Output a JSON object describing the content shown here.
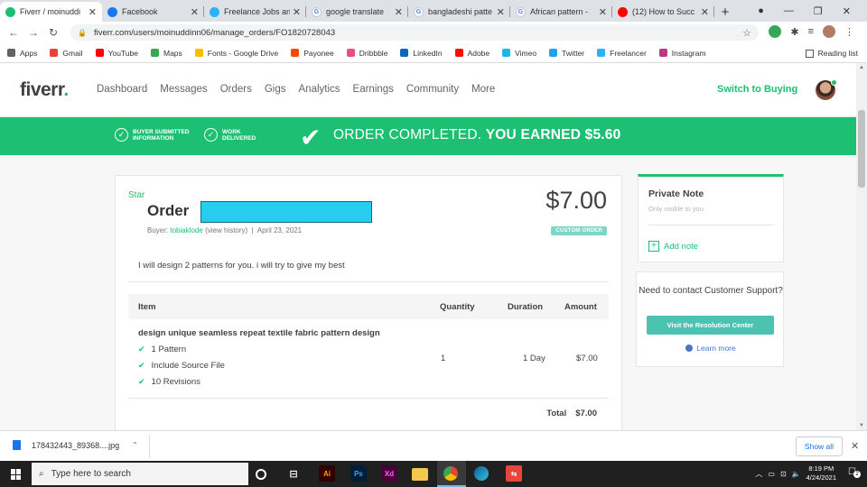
{
  "browser": {
    "tabs": [
      {
        "title": "Fiverr / moinuddi",
        "icon": "fiverr-icon",
        "color": "#1dbf73",
        "active": true
      },
      {
        "title": "Facebook",
        "icon": "facebook-icon",
        "color": "#1877f2",
        "active": false
      },
      {
        "title": "Freelance Jobs an",
        "icon": "freelancer-icon",
        "color": "#29b2fe",
        "active": false
      },
      {
        "title": "google translate",
        "icon": "google-icon",
        "color": "#ffffff",
        "active": false
      },
      {
        "title": "bangladeshi patte",
        "icon": "google-icon",
        "color": "#ffffff",
        "active": false
      },
      {
        "title": "African pattern -",
        "icon": "google-icon",
        "color": "#ffffff",
        "active": false
      },
      {
        "title": "(12) How to Succ",
        "icon": "youtube-icon",
        "color": "#ff0000",
        "active": false
      }
    ],
    "url": "fiverr.com/users/moinuddinn06/manage_orders/FO1820728043",
    "bookmarks": [
      {
        "label": "Apps",
        "color": "#5f6368"
      },
      {
        "label": "Gmail",
        "color": "#ea4335"
      },
      {
        "label": "YouTube",
        "color": "#ff0000"
      },
      {
        "label": "Maps",
        "color": "#34a853"
      },
      {
        "label": "Fonts - Google Drive",
        "color": "#fbbc04"
      },
      {
        "label": "Payonee",
        "color": "#ff4800"
      },
      {
        "label": "Dribbble",
        "color": "#ea4c89"
      },
      {
        "label": "LinkedIn",
        "color": "#0a66c2"
      },
      {
        "label": "Adobe",
        "color": "#fa0f00"
      },
      {
        "label": "Vimeo",
        "color": "#1ab7ea"
      },
      {
        "label": "Twitter",
        "color": "#1da1f2"
      },
      {
        "label": "Freelancer",
        "color": "#29b2fe"
      },
      {
        "label": "Instagram",
        "color": "#c13584"
      }
    ],
    "reading_list": "Reading list"
  },
  "fiverr": {
    "logo": "fiverr",
    "nav": [
      "Dashboard",
      "Messages",
      "Orders",
      "Gigs",
      "Analytics",
      "Earnings",
      "Community",
      "More"
    ],
    "switch_label": "Switch to Buying",
    "banner": {
      "step1": "BUYER SUBMITTED INFORMATION",
      "step2": "WORK DELIVERED",
      "message_plain": "ORDER COMPLETED.",
      "message_bold": "YOU EARNED $5.60"
    },
    "order": {
      "star": "Star",
      "title": "Order",
      "buyer_prefix": "Buyer:",
      "buyer_name": "tobiaklode",
      "view_history": "(view history)",
      "separator": "|",
      "date": "April 23, 2021",
      "price": "$7.00",
      "badge": "CUSTOM ORDER",
      "description": "I will design 2 patterns for you. i will try to give my best",
      "columns": {
        "item": "Item",
        "quantity": "Quantity",
        "duration": "Duration",
        "amount": "Amount"
      },
      "item_name": "design unique seamless repeat textile fabric pattern design",
      "features": [
        "1 Pattern",
        "Include Source File",
        "10 Revisions"
      ],
      "quantity": "1",
      "duration": "1 Day",
      "amount": "$7.00",
      "total_label": "Total",
      "total_value": "$7.00"
    },
    "private_note": {
      "heading": "Private Note",
      "subtitle": "Only visible to you",
      "add_label": "Add note"
    },
    "support": {
      "question": "Need to contact Customer Support?",
      "button": "Visit the Resolution Center",
      "learn_more": "Learn more"
    },
    "accent": "#1dbf73"
  },
  "downloads": {
    "file": "178432443_89368....jpg",
    "show_all": "Show all"
  },
  "taskbar": {
    "search_placeholder": "Type here to search",
    "time": "8:19 PM",
    "date": "4/24/2021",
    "notifications": "2"
  }
}
